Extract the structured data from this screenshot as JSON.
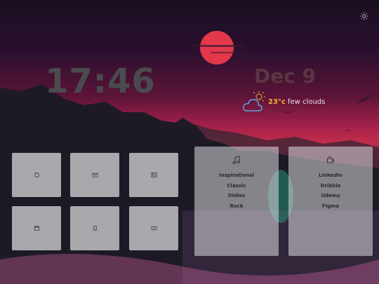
{
  "clock": {
    "time": "17:46"
  },
  "date": {
    "label": "Dec 9"
  },
  "weather": {
    "temperature": "23°c",
    "description": "few clouds",
    "icon": "cloud-sun-icon"
  },
  "settings": {
    "icon": "sun-icon"
  },
  "tiles": [
    {
      "icon": "github-icon"
    },
    {
      "icon": "mail-icon"
    },
    {
      "icon": "news-icon"
    },
    {
      "icon": "calendar-icon"
    },
    {
      "icon": "bookmark-icon"
    },
    {
      "icon": "youtube-icon"
    }
  ],
  "panels": {
    "music": {
      "icon": "music-note-icon",
      "items": [
        "Inspirational",
        "Classic",
        "Oldies",
        "Rock"
      ]
    },
    "links": {
      "icon": "coffee-icon",
      "items": [
        "LinkedIn",
        "Dribble",
        "Udemy",
        "Figma"
      ]
    }
  },
  "colors": {
    "tile": "#c8c8cc",
    "sun": "#e2394a",
    "temp": "#f2b233"
  }
}
